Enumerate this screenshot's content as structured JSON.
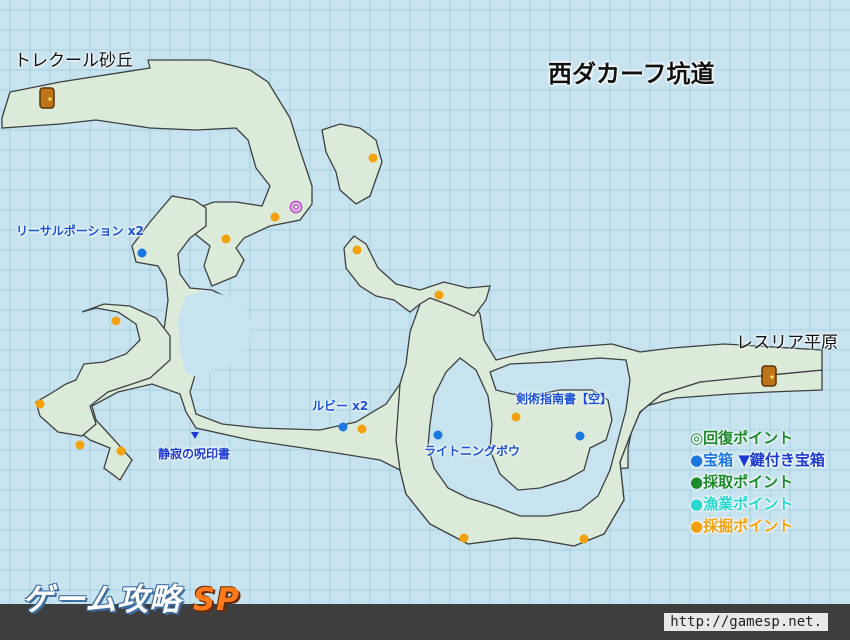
{
  "map": {
    "title": "西ダカーフ坑道",
    "areas": {
      "west": "トレクール砂丘",
      "east": "レスリア平原"
    },
    "items": {
      "lethal_potion": "リーサルポーション x2",
      "ruby": "ルビー x2",
      "silence_curse_book": "静寂の呪印書",
      "light_ningubow": "ライトニングボウ",
      "sword_manual": "剣術指南書【空】"
    }
  },
  "legend": {
    "recovery": "◎回復ポイント",
    "chest": "●宝箱",
    "locked_chest": "▼鍵付き宝箱",
    "gather": "●採取ポイント",
    "fishing": "●漁業ポイント",
    "mining": "●採掘ポイント"
  },
  "colors": {
    "background": "#c7e3ef",
    "grid": "#9ecbdf",
    "cave_fill": "#dcebd9",
    "cave_stroke": "#3d4040",
    "recovery": "#c24fd0",
    "chest": "#1c78e0",
    "locked_chest": "#1a3ad0",
    "gather": "#1a8a2a",
    "fishing": "#27d7d0",
    "mining": "#f5a10b",
    "exit_door": "#c07418",
    "footer": "#3e3e3e"
  },
  "icons": {
    "exit": "door-icon",
    "recovery": "double-circle-icon",
    "chest": "blue-dot-icon",
    "locked_chest": "blue-triangle-icon",
    "mining": "orange-dot-icon"
  },
  "footer": {
    "brand": "ゲーム攻略",
    "brand_sp": "SP",
    "url": "http://gamesp.net."
  }
}
